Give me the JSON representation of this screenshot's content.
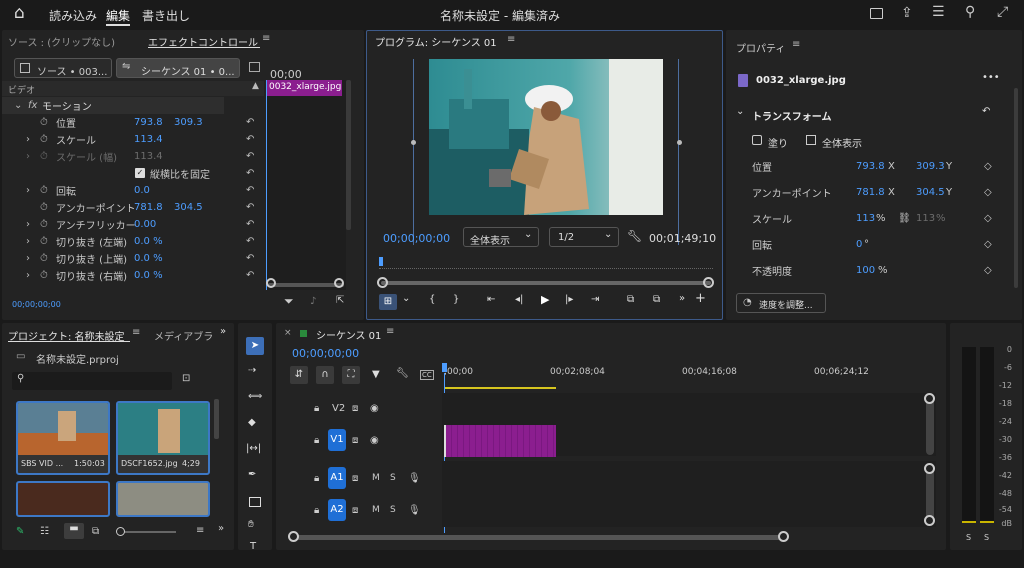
{
  "menu": {
    "home": "⌂",
    "items": [
      "読み込み",
      "編集",
      "書き出し"
    ],
    "title": "名称未設定 - 編集済み"
  },
  "source": {
    "tab_source": "ソース : (クリップなし)",
    "tab_effect": "エフェクトコントロール",
    "src_btn": "ソース • 003...",
    "seq_btn": "シーケンス 01 • 0...",
    "timecode": "00;00",
    "clip_label": "0032_xlarge.jpg",
    "video_label": "ビデオ",
    "rows": [
      {
        "name": "モーション",
        "v1": "",
        "v2": ""
      },
      {
        "name": "位置",
        "v1": "793.8",
        "v2": "309.3"
      },
      {
        "name": "スケール",
        "v1": "113.4",
        "v2": ""
      },
      {
        "name": "スケール (幅)",
        "v1": "113.4",
        "v2": ""
      },
      {
        "name": "縦横比を固定",
        "v1": "",
        "v2": ""
      },
      {
        "name": "回転",
        "v1": "0.0",
        "v2": ""
      },
      {
        "name": "アンカーポイント",
        "v1": "781.8",
        "v2": "304.5"
      },
      {
        "name": "アンチフリッカー",
        "v1": "0.00",
        "v2": ""
      },
      {
        "name": "切り抜き (左端)",
        "v1": "0.0 %",
        "v2": ""
      },
      {
        "name": "切り抜き (上端)",
        "v1": "0.0 %",
        "v2": ""
      },
      {
        "name": "切り抜き (右端)",
        "v1": "0.0 %",
        "v2": ""
      }
    ],
    "bottom_tc": "00;00;00;00"
  },
  "program": {
    "title": "プログラム: シーケンス 01",
    "tc_left": "00;00;00;00",
    "fit": "全体表示",
    "res": "1/2",
    "tc_right": "00;01;49;10"
  },
  "properties": {
    "title": "プロパティ",
    "clip": "0032_xlarge.jpg",
    "section": "トランスフォーム",
    "fill": "塗り",
    "full": "全体表示",
    "rows": [
      {
        "name": "位置",
        "v1": "793.8",
        "u1": "X",
        "v2": "309.3",
        "u2": "Y"
      },
      {
        "name": "アンカーポイント",
        "v1": "781.8",
        "u1": "X",
        "v2": "304.5",
        "u2": "Y"
      },
      {
        "name": "スケール",
        "v1": "113",
        "u1": "%",
        "v2": "113",
        "u2": "%"
      },
      {
        "name": "回転",
        "v1": "0",
        "u1": "°",
        "v2": "",
        "u2": ""
      },
      {
        "name": "不透明度",
        "v1": "100",
        "u1": "%",
        "v2": "",
        "u2": ""
      }
    ],
    "speed_btn": "速度を調整..."
  },
  "project": {
    "tab": "プロジェクト: 名称未設定",
    "tab2": "メディアブラ",
    "file": "名称未設定.prproj",
    "search_placeholder": "",
    "thumbs": [
      {
        "name": "SBS VID ...",
        "dur": "1:50:03"
      },
      {
        "name": "DSCF1652.jpg",
        "dur": "4;29"
      }
    ]
  },
  "timeline": {
    "title": "シーケンス 01",
    "tc": "00;00;00;00",
    "ticks": [
      ";00;00",
      "00;02;08;04",
      "00;04;16;08",
      "00;06;24;12"
    ],
    "tracks": [
      {
        "id": "V2",
        "type": "video"
      },
      {
        "id": "V1",
        "type": "video"
      },
      {
        "id": "A1",
        "type": "audio"
      },
      {
        "id": "A2",
        "type": "audio"
      }
    ]
  },
  "meter": {
    "labels": [
      "0",
      "-6",
      "-12",
      "-18",
      "-24",
      "-30",
      "-36",
      "-42",
      "-48",
      "-54",
      "dB"
    ],
    "bottom": [
      "S",
      "S"
    ]
  }
}
